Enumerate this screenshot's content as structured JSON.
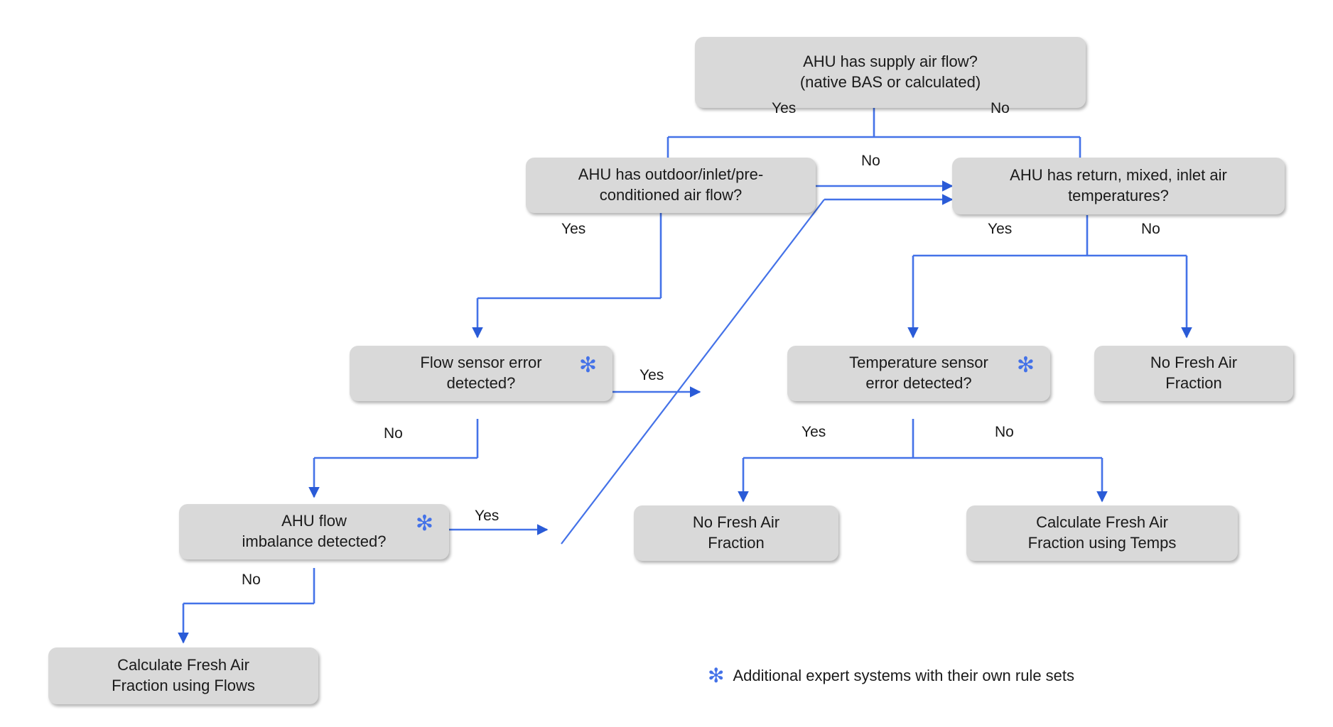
{
  "diagram": {
    "title": "AHU Fresh Air Fraction decision flowchart",
    "accent_color": "#4472e8",
    "node_fill": "#d9d9d9",
    "text_color": "#1a1a1a",
    "nodes": [
      {
        "id": "supply_air",
        "text": "AHU has supply air flow?\n(native BAS or calculated)",
        "star": false
      },
      {
        "id": "outdoor_flow",
        "text": "AHU has outdoor/inlet/pre-\nconditioned air flow?",
        "star": false
      },
      {
        "id": "return_temps",
        "text": "AHU has return,  mixed, inlet air\ntemperatures?",
        "star": false
      },
      {
        "id": "flow_sensor_error",
        "text": "Flow sensor error\ndetected?",
        "star": true
      },
      {
        "id": "temp_sensor_error",
        "text": "Temperature sensor\nerror detected?",
        "star": true
      },
      {
        "id": "no_faf_right",
        "text": "No Fresh Air\nFraction",
        "star": false
      },
      {
        "id": "flow_imbalance",
        "text": "AHU flow\nimbalance detected?",
        "star": true
      },
      {
        "id": "no_faf_mid",
        "text": "No Fresh Air\nFraction",
        "star": false
      },
      {
        "id": "calc_temps",
        "text": "Calculate Fresh Air\nFraction using Temps",
        "star": false
      },
      {
        "id": "calc_flows",
        "text": "Calculate Fresh Air\nFraction using Flows",
        "star": false
      }
    ],
    "edge_labels": [
      {
        "id": "supply_yes",
        "text": "Yes"
      },
      {
        "id": "supply_no",
        "text": "No"
      },
      {
        "id": "outdoor_no",
        "text": "No"
      },
      {
        "id": "outdoor_yes",
        "text": "Yes"
      },
      {
        "id": "temps_yes",
        "text": "Yes"
      },
      {
        "id": "temps_no",
        "text": "No"
      },
      {
        "id": "flow_sensor_yes",
        "text": "Yes"
      },
      {
        "id": "flow_sensor_no",
        "text": "No"
      },
      {
        "id": "tempsensor_yes",
        "text": "Yes"
      },
      {
        "id": "tempsensor_no",
        "text": "No"
      },
      {
        "id": "imbalance_yes",
        "text": "Yes"
      },
      {
        "id": "imbalance_no",
        "text": "No"
      }
    ],
    "footnote": {
      "marker": "✻",
      "text": "Additional expert systems with their own rule sets"
    },
    "star_glyph": "✻"
  }
}
